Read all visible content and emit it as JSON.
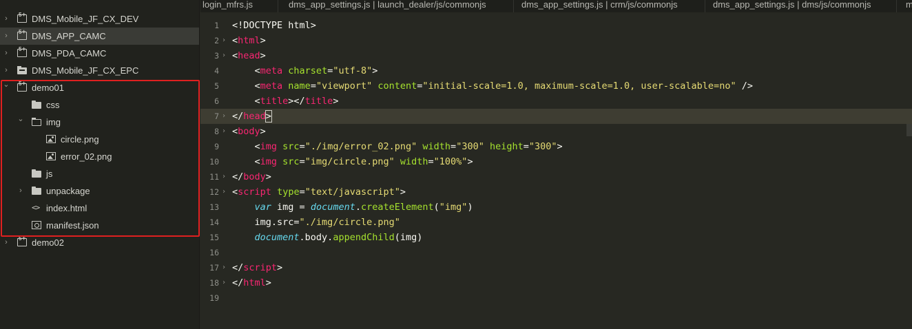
{
  "sidebar": {
    "items": [
      {
        "label": "DMS_Mobile_JF_CX_DEV",
        "icon": "project-icon",
        "expanded": false,
        "depth": 0
      },
      {
        "label": "DMS_APP_CAMC",
        "icon": "project-icon",
        "expanded": false,
        "depth": 0,
        "selected": true
      },
      {
        "label": "DMS_PDA_CAMC",
        "icon": "project-icon",
        "expanded": false,
        "depth": 0
      },
      {
        "label": "DMS_Mobile_JF_CX_EPC",
        "icon": "project-folder-icon",
        "expanded": false,
        "depth": 0
      },
      {
        "label": "demo01",
        "icon": "project-icon",
        "expanded": true,
        "depth": 0
      },
      {
        "label": "css",
        "icon": "folder-icon",
        "depth": 1
      },
      {
        "label": "img",
        "icon": "folder-open-icon",
        "expanded": true,
        "depth": 1
      },
      {
        "label": "circle.png",
        "icon": "image-file-icon",
        "depth": 2
      },
      {
        "label": "error_02.png",
        "icon": "image-file-icon",
        "depth": 2
      },
      {
        "label": "js",
        "icon": "folder-icon",
        "depth": 1
      },
      {
        "label": "unpackage",
        "icon": "folder-icon",
        "expanded": false,
        "depth": 1
      },
      {
        "label": "index.html",
        "icon": "code-file-icon",
        "depth": 1
      },
      {
        "label": "manifest.json",
        "icon": "settings-file-icon",
        "depth": 1
      },
      {
        "label": "demo02",
        "icon": "project-icon",
        "expanded": false,
        "depth": 0
      }
    ],
    "highlight_color": "#e02020"
  },
  "tabs": [
    "login_mfrs.js",
    "dms_app_settings.js | launch_dealer/js/commonjs",
    "dms_app_settings.js | crm/js/commonjs",
    "dms_app_settings.js | dms/js/commonjs",
    "m"
  ],
  "editor": {
    "current_line": 7,
    "lines": [
      {
        "n": "1",
        "fold": "",
        "code": [
          [
            "p",
            "<!DOCTYPE html>"
          ]
        ]
      },
      {
        "n": "2",
        "fold": "›",
        "code": [
          [
            "p",
            "<"
          ],
          [
            "tag",
            "html"
          ],
          [
            "p",
            ">"
          ]
        ]
      },
      {
        "n": "3",
        "fold": "›",
        "code": [
          [
            "p",
            "<"
          ],
          [
            "tag",
            "head"
          ],
          [
            "p",
            ">"
          ]
        ]
      },
      {
        "n": "4",
        "fold": "",
        "code": [
          [
            "p",
            "    <"
          ],
          [
            "tag",
            "meta"
          ],
          [
            "p",
            " "
          ],
          [
            "attr",
            "charset"
          ],
          [
            "p",
            "="
          ],
          [
            "str",
            "\"utf-8\""
          ],
          [
            "p",
            ">"
          ]
        ]
      },
      {
        "n": "5",
        "fold": "",
        "code": [
          [
            "p",
            "    <"
          ],
          [
            "tag",
            "meta"
          ],
          [
            "p",
            " "
          ],
          [
            "attr",
            "name"
          ],
          [
            "p",
            "="
          ],
          [
            "str",
            "\"viewport\""
          ],
          [
            "p",
            " "
          ],
          [
            "attr",
            "content"
          ],
          [
            "p",
            "="
          ],
          [
            "str",
            "\"initial-scale=1.0, maximum-scale=1.0, user-scalable=no\""
          ],
          [
            "p",
            " />"
          ]
        ]
      },
      {
        "n": "6",
        "fold": "",
        "code": [
          [
            "p",
            "    <"
          ],
          [
            "tag",
            "title"
          ],
          [
            "p",
            "></"
          ],
          [
            "tag",
            "title"
          ],
          [
            "p",
            ">"
          ]
        ]
      },
      {
        "n": "7",
        "fold": "›",
        "code": [
          [
            "p",
            "</"
          ],
          [
            "tag",
            "head"
          ],
          [
            "p",
            ">"
          ]
        ]
      },
      {
        "n": "8",
        "fold": "›",
        "code": [
          [
            "p",
            "<"
          ],
          [
            "tag",
            "body"
          ],
          [
            "p",
            ">"
          ]
        ]
      },
      {
        "n": "9",
        "fold": "",
        "code": [
          [
            "p",
            "    <"
          ],
          [
            "tag",
            "img"
          ],
          [
            "p",
            " "
          ],
          [
            "attr",
            "src"
          ],
          [
            "p",
            "="
          ],
          [
            "str",
            "\"./img/error_02.png\""
          ],
          [
            "p",
            " "
          ],
          [
            "attr",
            "width"
          ],
          [
            "p",
            "="
          ],
          [
            "str",
            "\"300\""
          ],
          [
            "p",
            " "
          ],
          [
            "attr",
            "height"
          ],
          [
            "p",
            "="
          ],
          [
            "str",
            "\"300\""
          ],
          [
            "p",
            ">"
          ]
        ]
      },
      {
        "n": "10",
        "fold": "",
        "code": [
          [
            "p",
            "    <"
          ],
          [
            "tag",
            "img"
          ],
          [
            "p",
            " "
          ],
          [
            "attr",
            "src"
          ],
          [
            "p",
            "="
          ],
          [
            "str",
            "\"img/circle.png\""
          ],
          [
            "p",
            " "
          ],
          [
            "attr",
            "width"
          ],
          [
            "p",
            "="
          ],
          [
            "str",
            "\"100%\""
          ],
          [
            "p",
            ">"
          ]
        ]
      },
      {
        "n": "11",
        "fold": "›",
        "code": [
          [
            "p",
            "</"
          ],
          [
            "tag",
            "body"
          ],
          [
            "p",
            ">"
          ]
        ]
      },
      {
        "n": "12",
        "fold": "›",
        "code": [
          [
            "p",
            "<"
          ],
          [
            "tag",
            "script"
          ],
          [
            "p",
            " "
          ],
          [
            "attr",
            "type"
          ],
          [
            "p",
            "="
          ],
          [
            "str",
            "\"text/javascript\""
          ],
          [
            "p",
            ">"
          ]
        ]
      },
      {
        "n": "13",
        "fold": "",
        "code": [
          [
            "p",
            "    "
          ],
          [
            "kw",
            "var"
          ],
          [
            "p",
            " img = "
          ],
          [
            "obj",
            "document"
          ],
          [
            "p",
            "."
          ],
          [
            "fn",
            "createElement"
          ],
          [
            "p",
            "("
          ],
          [
            "str",
            "\"img\""
          ],
          [
            "p",
            ")"
          ]
        ]
      },
      {
        "n": "14",
        "fold": "",
        "code": [
          [
            "p",
            "    img.src="
          ],
          [
            "str",
            "\"./img/circle.png\""
          ]
        ]
      },
      {
        "n": "15",
        "fold": "",
        "code": [
          [
            "p",
            "    "
          ],
          [
            "obj",
            "document"
          ],
          [
            "p",
            ".body."
          ],
          [
            "fn",
            "appendChild"
          ],
          [
            "p",
            "(img)"
          ]
        ]
      },
      {
        "n": "16",
        "fold": "",
        "code": []
      },
      {
        "n": "17",
        "fold": "›",
        "code": [
          [
            "p",
            "</"
          ],
          [
            "tag",
            "script"
          ],
          [
            "p",
            ">"
          ]
        ]
      },
      {
        "n": "18",
        "fold": "›",
        "code": [
          [
            "p",
            "</"
          ],
          [
            "tag",
            "html"
          ],
          [
            "p",
            ">"
          ]
        ]
      },
      {
        "n": "19",
        "fold": "",
        "code": []
      }
    ]
  }
}
